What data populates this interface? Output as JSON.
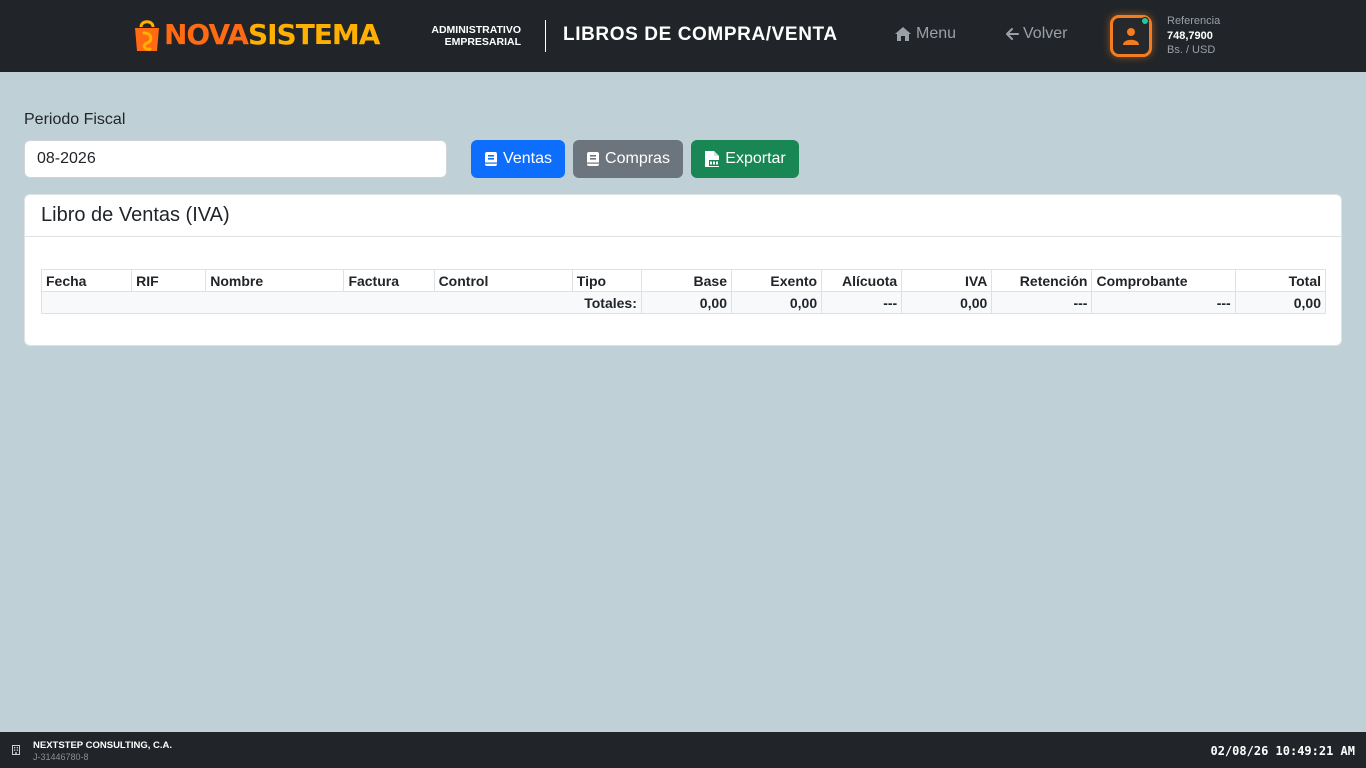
{
  "header": {
    "brand_part1": "NOVA",
    "brand_part2": "SISTEMA",
    "tagline_line1": "ADMINISTRATIVO",
    "tagline_line2": "EMPRESARIAL",
    "title": "LIBROS DE COMPRA/VENTA",
    "nav": {
      "menu_label": "Menu",
      "back_label": "Volver"
    },
    "reference": {
      "label": "Referencia",
      "value": "748,7900",
      "unit": "Bs. / USD"
    },
    "colors": {
      "brand_orange": "#ff6a13",
      "brand_yellow": "#ffb000",
      "bar": "#212529"
    }
  },
  "filters": {
    "period_label": "Periodo Fiscal",
    "period_value": "08-2026",
    "buttons": {
      "ventas": "Ventas",
      "compras": "Compras",
      "exportar": "Exportar"
    },
    "icons": {
      "ventas": "book-icon",
      "compras": "book-icon",
      "exportar": "file-csv-icon"
    }
  },
  "card": {
    "title": "Libro de Ventas (IVA)",
    "table": {
      "columns": [
        "Fecha",
        "RIF",
        "Nombre",
        "Factura",
        "Control",
        "Tipo",
        "Base",
        "Exento",
        "Alícuota",
        "IVA",
        "Retención",
        "Comprobante",
        "Total"
      ],
      "totals": {
        "label": "Totales:",
        "base": "0,00",
        "exento": "0,00",
        "alicuota": "---",
        "iva": "0,00",
        "retencion": "---",
        "comprobante": "---",
        "total": "0,00"
      }
    }
  },
  "footer": {
    "company": "NEXTSTEP CONSULTING, C.A.",
    "rif": "J-31446780-8",
    "datetime": "02/08/26 10:49:21 AM"
  }
}
